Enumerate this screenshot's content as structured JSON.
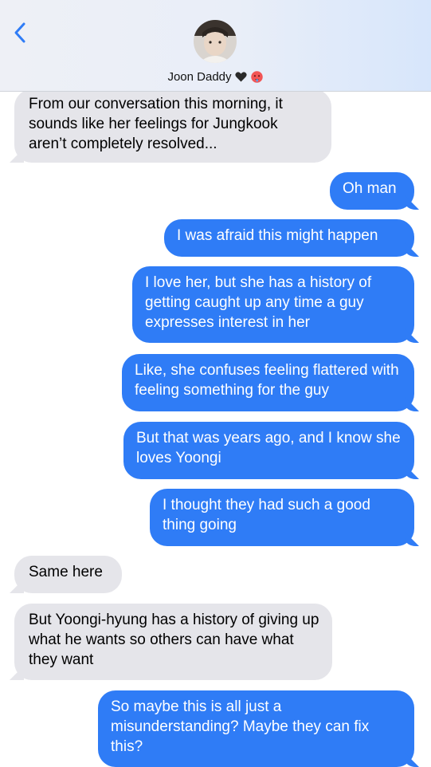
{
  "header": {
    "contact_name": "Joon Daddy",
    "back_icon": "chevron-left-icon",
    "name_emojis": [
      "black-heart-icon",
      "hot-face-emoji-icon"
    ],
    "accent_color": "#2f7cf6"
  },
  "messages": [
    {
      "from": "contact",
      "text": "From our conversation this morning, it sounds like her feelings for Jungkook aren’t completely resolved..."
    },
    {
      "from": "me",
      "text": "Oh man"
    },
    {
      "from": "me",
      "text": "I was afraid this might happen"
    },
    {
      "from": "me",
      "text": "I love her, but she has a history of getting caught up any time a guy expresses interest in her"
    },
    {
      "from": "me",
      "text": "Like, she confuses feeling flattered with feeling something for the guy"
    },
    {
      "from": "me",
      "text": "But that was years ago, and I know she loves Yoongi"
    },
    {
      "from": "me",
      "text": "I thought they had such a good thing going"
    },
    {
      "from": "contact",
      "text": "Same here"
    },
    {
      "from": "contact",
      "text": "But Yoongi-hyung has a history of giving up what he wants so others can have what they want"
    },
    {
      "from": "me",
      "text": "So maybe this is all just a misunderstanding? Maybe they can fix this?"
    }
  ]
}
